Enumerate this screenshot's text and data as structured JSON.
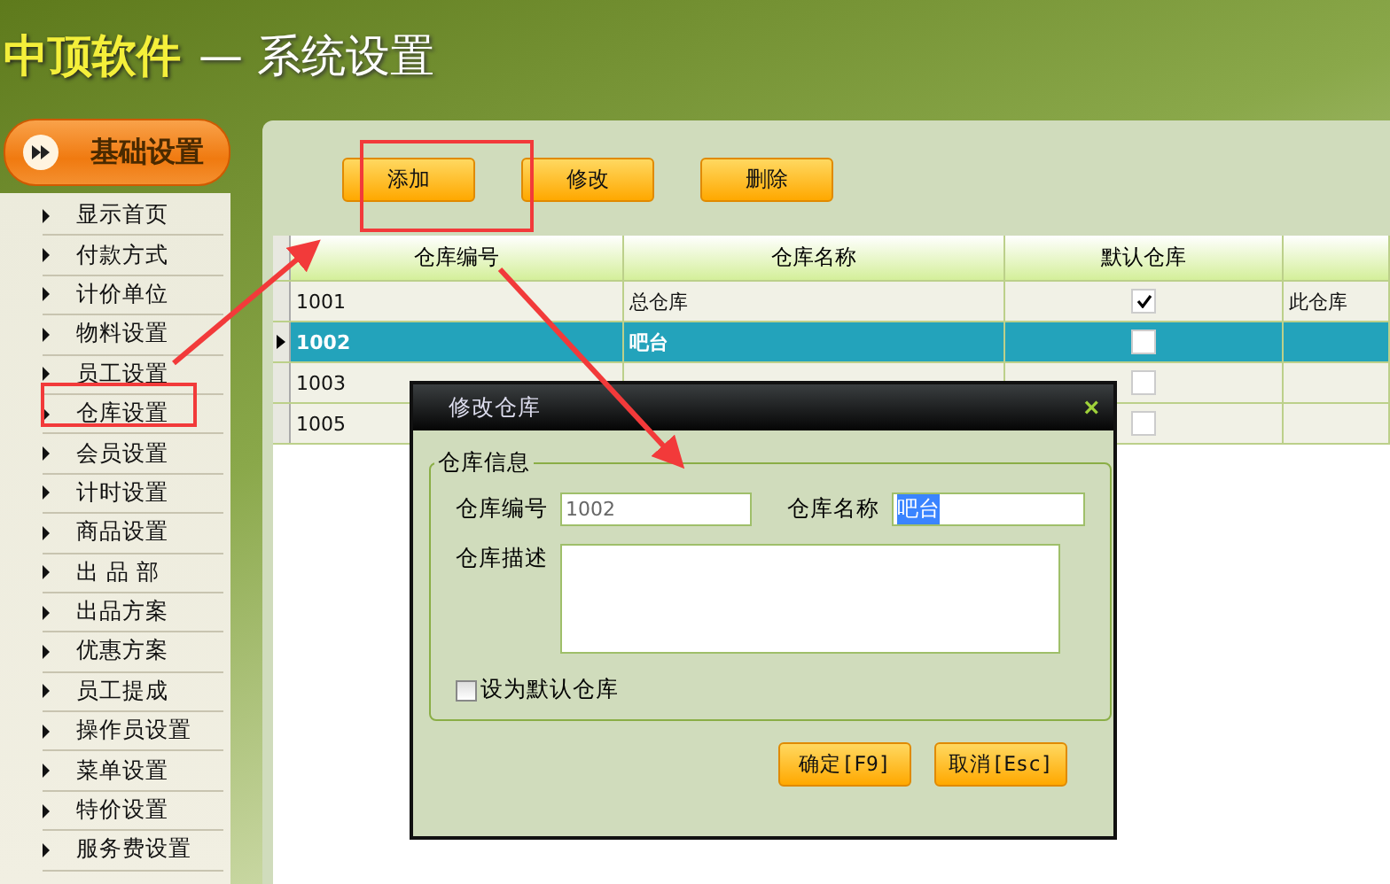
{
  "header": {
    "brand": "中顶软件",
    "title": "— 系统设置"
  },
  "sidebar": {
    "header": "基础设置",
    "items": [
      {
        "label": "显示首页"
      },
      {
        "label": "付款方式"
      },
      {
        "label": "计价单位"
      },
      {
        "label": "物料设置"
      },
      {
        "label": "员工设置"
      },
      {
        "label": "仓库设置"
      },
      {
        "label": "会员设置"
      },
      {
        "label": "计时设置"
      },
      {
        "label": "商品设置"
      },
      {
        "label": "出 品 部"
      },
      {
        "label": "出品方案"
      },
      {
        "label": "优惠方案"
      },
      {
        "label": "员工提成"
      },
      {
        "label": "操作员设置"
      },
      {
        "label": "菜单设置"
      },
      {
        "label": "特价设置"
      },
      {
        "label": "服务费设置"
      }
    ]
  },
  "toolbar": [
    "添加",
    "修改",
    "删除"
  ],
  "table": {
    "columns": [
      "仓库编号",
      "仓库名称",
      "默认仓库"
    ],
    "rows": [
      {
        "code": "1001",
        "name": "总仓库",
        "default": true,
        "selected": false,
        "column_4": "此仓库"
      },
      {
        "code": "1002",
        "name": "吧台",
        "default": false,
        "selected": true
      },
      {
        "code": "1003",
        "default": false,
        "selected": false
      },
      {
        "code": "1005",
        "default": false,
        "selected": false
      }
    ]
  },
  "dialog": {
    "title": "修改仓库",
    "close": "×",
    "group": "仓库信息",
    "code_label": "仓库编号",
    "code_value": "1002",
    "name_label": "仓库名称",
    "name_value": "吧台",
    "desc_label": "仓库描述",
    "default_label": "设为默认仓库",
    "default_checked": false,
    "ok": "确定[F9]",
    "cancel": "取消[Esc]"
  }
}
